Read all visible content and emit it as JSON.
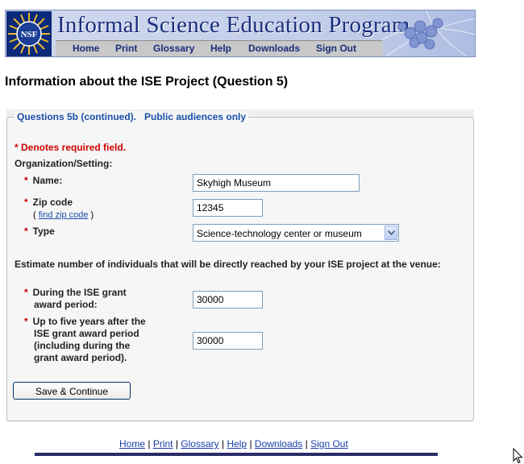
{
  "banner": {
    "logo_label": "NSF",
    "title": "Informal Science Education Program"
  },
  "topnav": {
    "home": "Home",
    "print": "Print",
    "glossary": "Glossary",
    "help": "Help",
    "downloads": "Downloads",
    "signout": "Sign Out"
  },
  "page": {
    "title": "Information about the ISE Project (Question 5)"
  },
  "form": {
    "legend_question": "Questions 5b (continued).",
    "legend_audience": "Public audiences only",
    "required_note": "* Denotes required field.",
    "section_label": "Organization/Setting:",
    "star": "*",
    "name_label": "Name:",
    "name_value": "Skyhigh Museum",
    "zip_label": "Zip code",
    "zip_open": "( ",
    "zip_link": "find zip code",
    "zip_close": " )",
    "zip_value": "12345",
    "type_label": "Type",
    "type_selected": "Science-technology center or museum",
    "estimate_text": "Estimate number of individuals that will be directly reached by your ISE project at the venue:",
    "during_label_1": "During the ISE grant",
    "during_label_2": "award period:",
    "during_value": "30000",
    "after_label_1": "Up to five years after the",
    "after_label_2": "ISE grant award period",
    "after_label_3": "(including during the",
    "after_label_4": "grant award period).",
    "after_value": "30000",
    "save_button": "Save & Continue"
  },
  "footer": {
    "home": "Home",
    "print": "Print",
    "glossary": "Glossary",
    "help": "Help",
    "downloads": "Downloads",
    "signout": "Sign Out",
    "sep": " | "
  },
  "colors": {
    "banner_title": "#1a2d7c",
    "legend": "#1a4fa8",
    "required": "#cc0000",
    "footer_bar": "#2a2c66"
  },
  "icons": [
    "nsf-logo-icon",
    "molecule-graphic-icon",
    "dropdown-arrow-icon",
    "mouse-cursor-icon"
  ]
}
